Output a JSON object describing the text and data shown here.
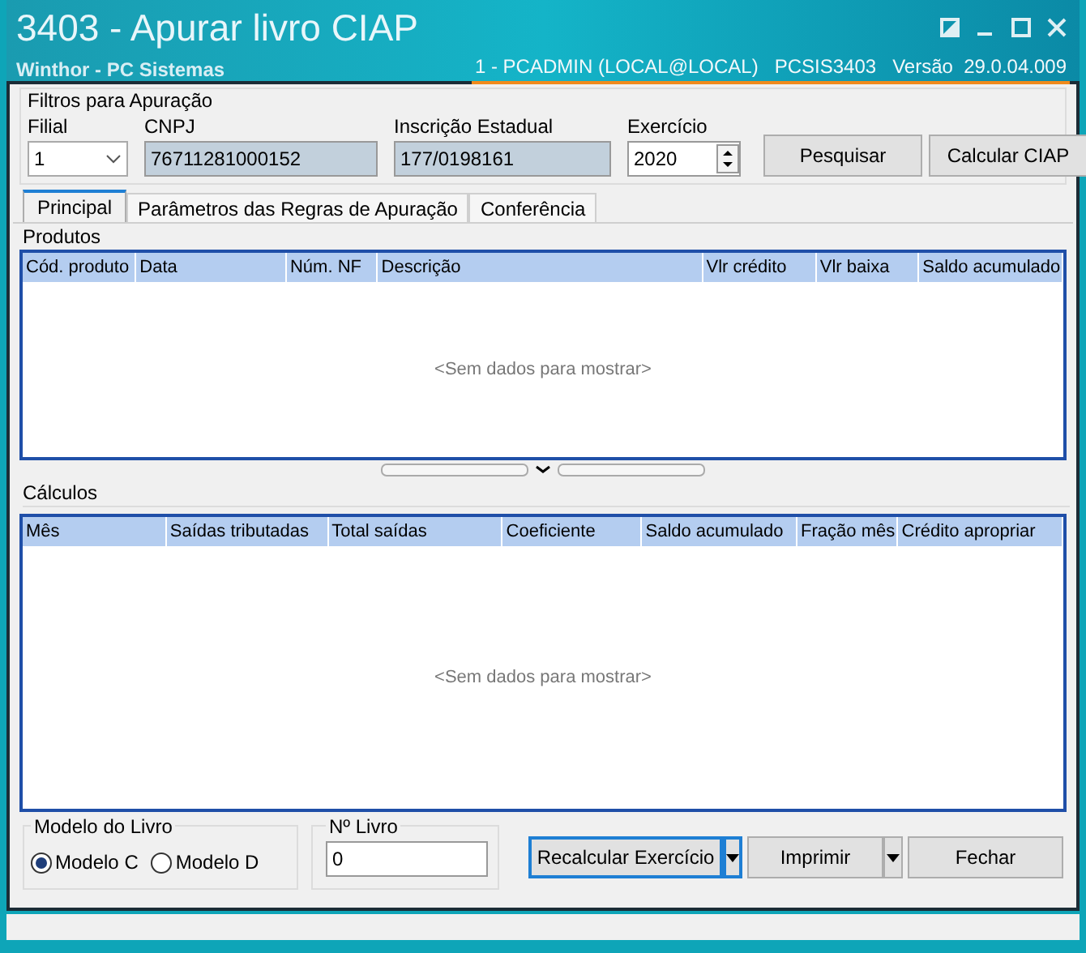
{
  "window": {
    "title": "3403 - Apurar livro CIAP",
    "subtitle": "Winthor - PC Sistemas",
    "session": "1 - PCADMIN (LOCAL@LOCAL)",
    "program": "PCSIS3403",
    "version": "Versão  29.0.04.009"
  },
  "filters": {
    "title": "Filtros para Apuração",
    "filial": {
      "label": "Filial",
      "value": "1"
    },
    "cnpj": {
      "label": "CNPJ",
      "value": "76711281000152"
    },
    "ie": {
      "label": "Inscrição Estadual",
      "value": "177/0198161"
    },
    "exercicio": {
      "label": "Exercício",
      "value": "2020"
    },
    "buttons": [
      "Pesquisar",
      "Calcular CIAP"
    ]
  },
  "tabs": [
    {
      "label": "Principal",
      "selected": true
    },
    {
      "label": "Parâmetros das Regras de Apuração",
      "selected": false
    },
    {
      "label": "Conferência",
      "selected": false
    }
  ],
  "produtos": {
    "title": "Produtos",
    "columns": [
      "Cód. produto",
      "Data",
      "Núm. NF",
      "Descrição",
      "Vlr crédito",
      "Vlr baixa",
      "Saldo acumulado"
    ],
    "empty": "<Sem dados para mostrar>"
  },
  "calculos": {
    "title": "Cálculos",
    "columns": [
      "Mês",
      "Saídas tributadas",
      "Total saídas",
      "Coeficiente",
      "Saldo acumulado",
      "Fração mês",
      "Crédito apropriar"
    ],
    "empty": "<Sem dados para mostrar>"
  },
  "modelo": {
    "title": "Modelo do Livro",
    "options": [
      {
        "label": "Modelo C",
        "selected": true
      },
      {
        "label": "Modelo D",
        "selected": false
      }
    ]
  },
  "livro": {
    "label": "Nº Livro",
    "value": "0"
  },
  "actions": [
    {
      "label": "Recalcular Exercício",
      "dropdown": true,
      "focused": true
    },
    {
      "label": "Imprimir",
      "dropdown": true,
      "focused": false
    },
    {
      "label": "Fechar",
      "dropdown": false,
      "focused": false
    }
  ]
}
